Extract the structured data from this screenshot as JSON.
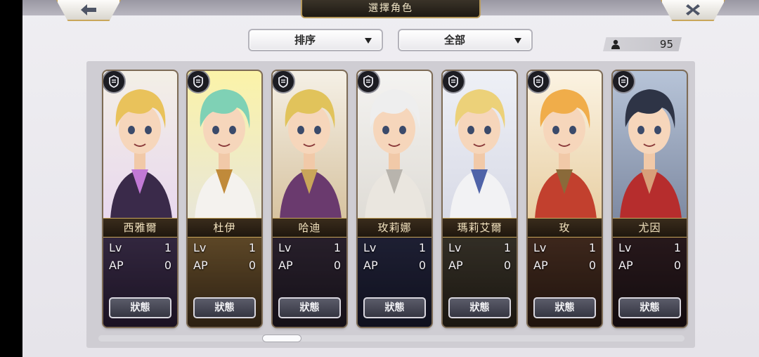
{
  "header": {
    "title": "選擇角色"
  },
  "controls": {
    "sort_label": "排序",
    "filter_label": "全部",
    "count": "95"
  },
  "icons": {
    "back": "back-arrow-icon",
    "close": "close-x-icon",
    "count": "person-icon",
    "rank": "armor-rank-icon"
  },
  "scrollbar": {
    "position": 0.3
  },
  "characters": [
    {
      "name": "西雅爾",
      "lv_label": "Lv",
      "lv": "1",
      "ap_label": "AP",
      "ap": "0",
      "status_label": "狀態"
    },
    {
      "name": "杜伊",
      "lv_label": "Lv",
      "lv": "1",
      "ap_label": "AP",
      "ap": "0",
      "status_label": "狀態"
    },
    {
      "name": "哈迪",
      "lv_label": "Lv",
      "lv": "1",
      "ap_label": "AP",
      "ap": "0",
      "status_label": "狀態"
    },
    {
      "name": "玫莉娜",
      "lv_label": "Lv",
      "lv": "1",
      "ap_label": "AP",
      "ap": "0",
      "status_label": "狀態"
    },
    {
      "name": "瑪莉艾爾",
      "lv_label": "Lv",
      "lv": "1",
      "ap_label": "AP",
      "ap": "0",
      "status_label": "狀態"
    },
    {
      "name": "玫",
      "lv_label": "Lv",
      "lv": "1",
      "ap_label": "AP",
      "ap": "0",
      "status_label": "狀態"
    },
    {
      "name": "尤因",
      "lv_label": "Lv",
      "lv": "1",
      "ap_label": "AP",
      "ap": "0",
      "status_label": "狀態"
    }
  ]
}
